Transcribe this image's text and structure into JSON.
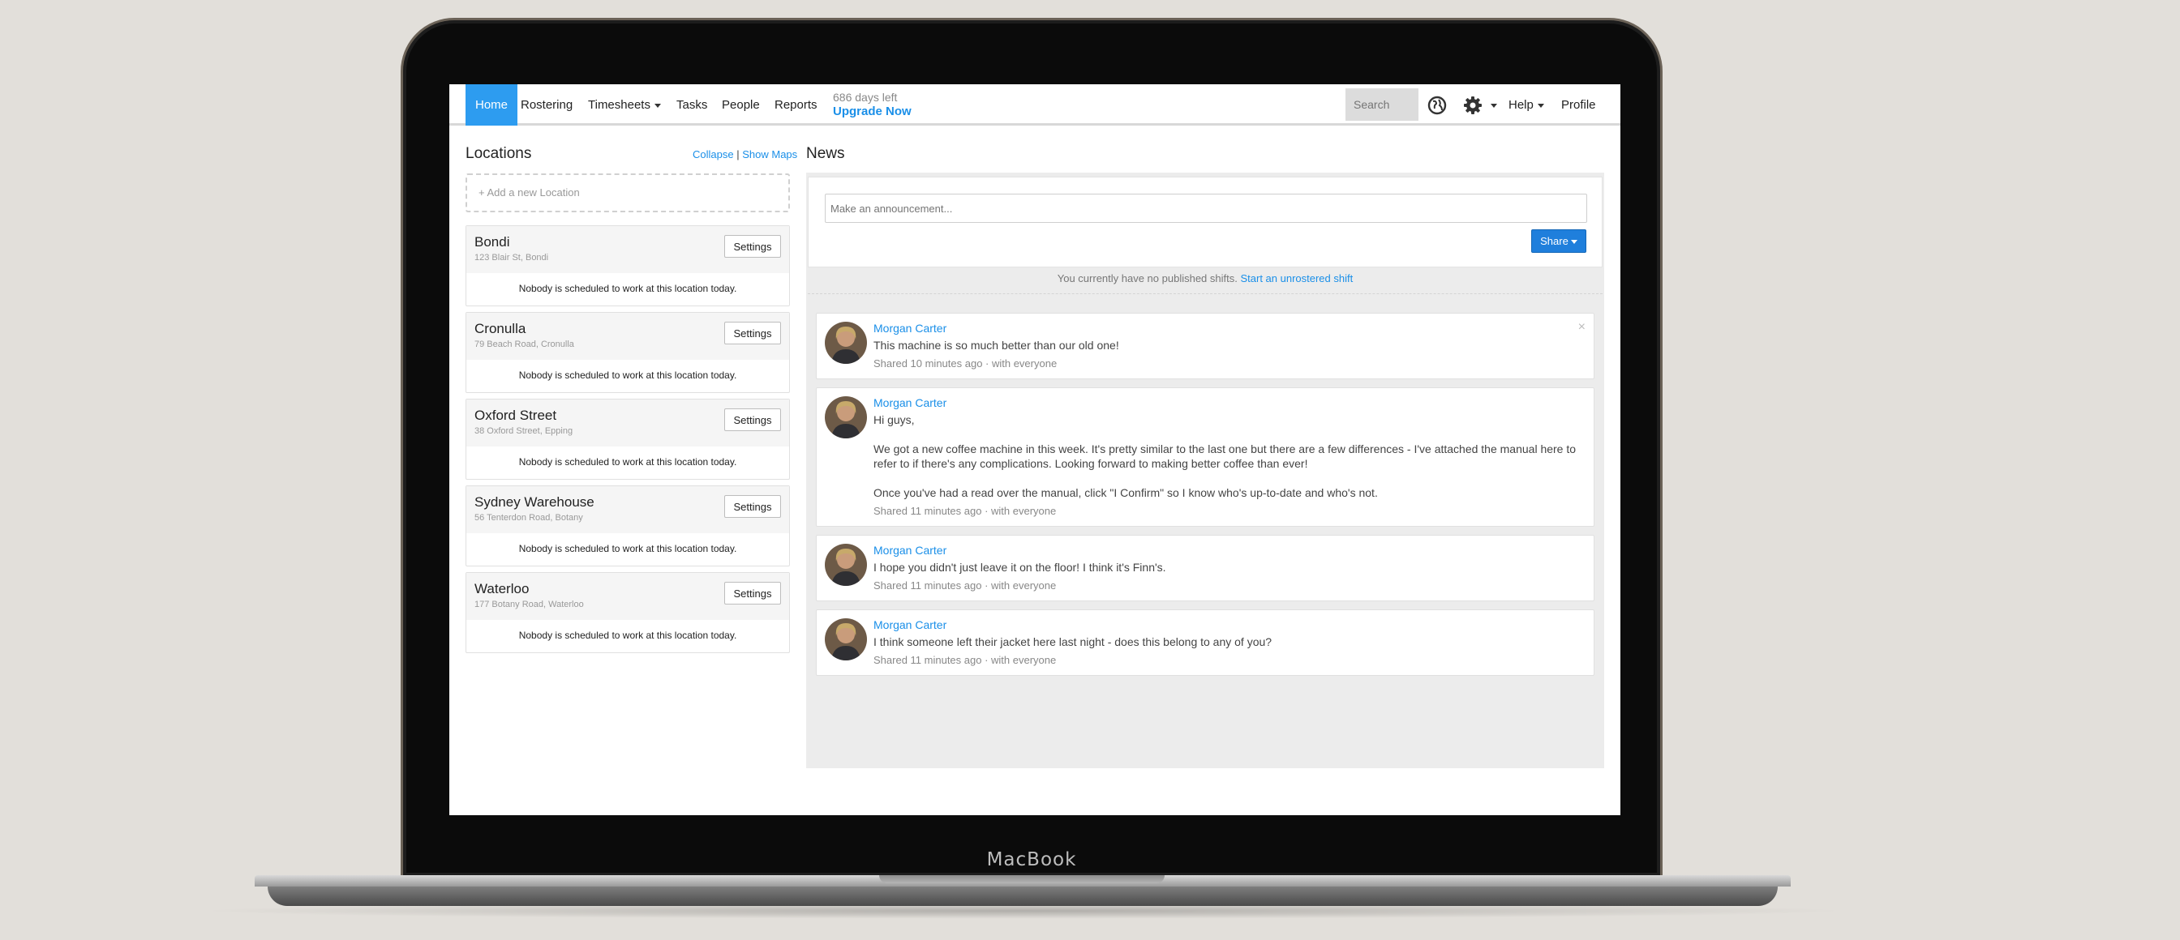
{
  "device": {
    "brand": "MacBook"
  },
  "nav": {
    "home": "Home",
    "rostering": "Rostering",
    "timesheets": "Timesheets",
    "tasks": "Tasks",
    "people": "People",
    "reports": "Reports",
    "days_left": "686 days left",
    "upgrade": "Upgrade Now",
    "search_placeholder": "Search",
    "help": "Help",
    "profile": "Profile"
  },
  "locations": {
    "title": "Locations",
    "collapse": "Collapse",
    "separator": "|",
    "show_maps": "Show Maps",
    "add_new": "Add a new Location",
    "items": [
      {
        "name": "Bondi",
        "address": "123 Blair St, Bondi",
        "button": "Settings",
        "message": "Nobody is scheduled to work at this location today."
      },
      {
        "name": "Cronulla",
        "address": "79 Beach Road, Cronulla",
        "button": "Settings",
        "message": "Nobody is scheduled to work at this location today."
      },
      {
        "name": "Oxford Street",
        "address": "38 Oxford Street, Epping",
        "button": "Settings",
        "message": "Nobody is scheduled to work at this location today."
      },
      {
        "name": "Sydney Warehouse",
        "address": "56 Tenterdon Road, Botany",
        "button": "Settings",
        "message": "Nobody is scheduled to work at this location today."
      },
      {
        "name": "Waterloo",
        "address": "177 Botany Road, Waterloo",
        "button": "Settings",
        "message": "Nobody is scheduled to work at this location today."
      }
    ]
  },
  "news": {
    "title": "News",
    "announcement_placeholder": "Make an announcement...",
    "share_label": "Share",
    "no_shifts_text": "You currently have no published shifts.",
    "no_shifts_link": "Start an unrostered shift",
    "posts": [
      {
        "author": "Morgan Carter",
        "text1": "This machine is so much better than our old one!",
        "meta": "Shared 10 minutes ago · with everyone",
        "close": "×"
      },
      {
        "author": "Morgan Carter",
        "text1": "Hi guys,",
        "text2": "We got a new coffee machine in this week. It's pretty similar to the last one but there are a few differences - I've attached the manual here to refer to if there's any complications. Looking forward to making better coffee than ever!",
        "text3": "Once you've had a read over the manual, click \"I Confirm\" so I know who's up-to-date and who's not.",
        "meta": "Shared 11 minutes ago · with everyone"
      },
      {
        "author": "Morgan Carter",
        "text1": "I hope you didn't just leave it on the floor! I think it's Finn's.",
        "meta": "Shared 11 minutes ago · with everyone"
      },
      {
        "author": "Morgan Carter",
        "text1": "I think someone left their jacket here last night - does this belong to any of you?",
        "meta": "Shared 11 minutes ago · with everyone"
      }
    ]
  }
}
